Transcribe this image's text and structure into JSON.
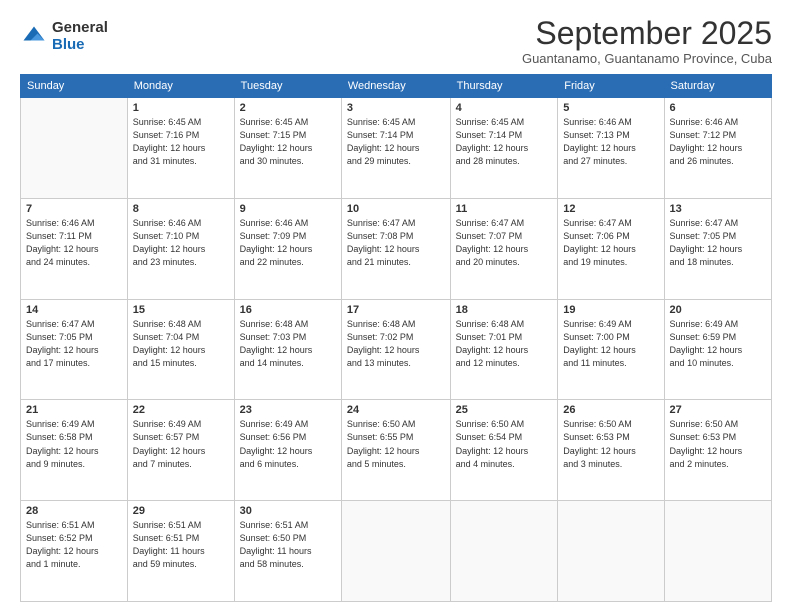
{
  "logo": {
    "general": "General",
    "blue": "Blue"
  },
  "title": "September 2025",
  "location": "Guantanamo, Guantanamo Province, Cuba",
  "weekdays": [
    "Sunday",
    "Monday",
    "Tuesday",
    "Wednesday",
    "Thursday",
    "Friday",
    "Saturday"
  ],
  "weeks": [
    [
      {
        "num": "",
        "detail": ""
      },
      {
        "num": "1",
        "detail": "Sunrise: 6:45 AM\nSunset: 7:16 PM\nDaylight: 12 hours\nand 31 minutes."
      },
      {
        "num": "2",
        "detail": "Sunrise: 6:45 AM\nSunset: 7:15 PM\nDaylight: 12 hours\nand 30 minutes."
      },
      {
        "num": "3",
        "detail": "Sunrise: 6:45 AM\nSunset: 7:14 PM\nDaylight: 12 hours\nand 29 minutes."
      },
      {
        "num": "4",
        "detail": "Sunrise: 6:45 AM\nSunset: 7:14 PM\nDaylight: 12 hours\nand 28 minutes."
      },
      {
        "num": "5",
        "detail": "Sunrise: 6:46 AM\nSunset: 7:13 PM\nDaylight: 12 hours\nand 27 minutes."
      },
      {
        "num": "6",
        "detail": "Sunrise: 6:46 AM\nSunset: 7:12 PM\nDaylight: 12 hours\nand 26 minutes."
      }
    ],
    [
      {
        "num": "7",
        "detail": "Sunrise: 6:46 AM\nSunset: 7:11 PM\nDaylight: 12 hours\nand 24 minutes."
      },
      {
        "num": "8",
        "detail": "Sunrise: 6:46 AM\nSunset: 7:10 PM\nDaylight: 12 hours\nand 23 minutes."
      },
      {
        "num": "9",
        "detail": "Sunrise: 6:46 AM\nSunset: 7:09 PM\nDaylight: 12 hours\nand 22 minutes."
      },
      {
        "num": "10",
        "detail": "Sunrise: 6:47 AM\nSunset: 7:08 PM\nDaylight: 12 hours\nand 21 minutes."
      },
      {
        "num": "11",
        "detail": "Sunrise: 6:47 AM\nSunset: 7:07 PM\nDaylight: 12 hours\nand 20 minutes."
      },
      {
        "num": "12",
        "detail": "Sunrise: 6:47 AM\nSunset: 7:06 PM\nDaylight: 12 hours\nand 19 minutes."
      },
      {
        "num": "13",
        "detail": "Sunrise: 6:47 AM\nSunset: 7:05 PM\nDaylight: 12 hours\nand 18 minutes."
      }
    ],
    [
      {
        "num": "14",
        "detail": "Sunrise: 6:47 AM\nSunset: 7:05 PM\nDaylight: 12 hours\nand 17 minutes."
      },
      {
        "num": "15",
        "detail": "Sunrise: 6:48 AM\nSunset: 7:04 PM\nDaylight: 12 hours\nand 15 minutes."
      },
      {
        "num": "16",
        "detail": "Sunrise: 6:48 AM\nSunset: 7:03 PM\nDaylight: 12 hours\nand 14 minutes."
      },
      {
        "num": "17",
        "detail": "Sunrise: 6:48 AM\nSunset: 7:02 PM\nDaylight: 12 hours\nand 13 minutes."
      },
      {
        "num": "18",
        "detail": "Sunrise: 6:48 AM\nSunset: 7:01 PM\nDaylight: 12 hours\nand 12 minutes."
      },
      {
        "num": "19",
        "detail": "Sunrise: 6:49 AM\nSunset: 7:00 PM\nDaylight: 12 hours\nand 11 minutes."
      },
      {
        "num": "20",
        "detail": "Sunrise: 6:49 AM\nSunset: 6:59 PM\nDaylight: 12 hours\nand 10 minutes."
      }
    ],
    [
      {
        "num": "21",
        "detail": "Sunrise: 6:49 AM\nSunset: 6:58 PM\nDaylight: 12 hours\nand 9 minutes."
      },
      {
        "num": "22",
        "detail": "Sunrise: 6:49 AM\nSunset: 6:57 PM\nDaylight: 12 hours\nand 7 minutes."
      },
      {
        "num": "23",
        "detail": "Sunrise: 6:49 AM\nSunset: 6:56 PM\nDaylight: 12 hours\nand 6 minutes."
      },
      {
        "num": "24",
        "detail": "Sunrise: 6:50 AM\nSunset: 6:55 PM\nDaylight: 12 hours\nand 5 minutes."
      },
      {
        "num": "25",
        "detail": "Sunrise: 6:50 AM\nSunset: 6:54 PM\nDaylight: 12 hours\nand 4 minutes."
      },
      {
        "num": "26",
        "detail": "Sunrise: 6:50 AM\nSunset: 6:53 PM\nDaylight: 12 hours\nand 3 minutes."
      },
      {
        "num": "27",
        "detail": "Sunrise: 6:50 AM\nSunset: 6:53 PM\nDaylight: 12 hours\nand 2 minutes."
      }
    ],
    [
      {
        "num": "28",
        "detail": "Sunrise: 6:51 AM\nSunset: 6:52 PM\nDaylight: 12 hours\nand 1 minute."
      },
      {
        "num": "29",
        "detail": "Sunrise: 6:51 AM\nSunset: 6:51 PM\nDaylight: 11 hours\nand 59 minutes."
      },
      {
        "num": "30",
        "detail": "Sunrise: 6:51 AM\nSunset: 6:50 PM\nDaylight: 11 hours\nand 58 minutes."
      },
      {
        "num": "",
        "detail": ""
      },
      {
        "num": "",
        "detail": ""
      },
      {
        "num": "",
        "detail": ""
      },
      {
        "num": "",
        "detail": ""
      }
    ]
  ]
}
